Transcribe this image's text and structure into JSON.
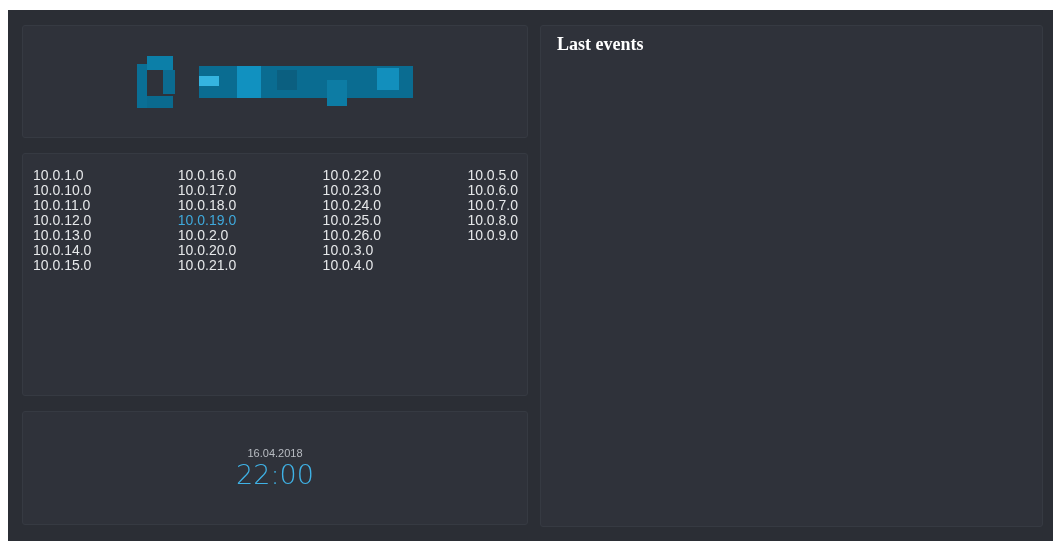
{
  "networks": [
    {
      "label": "10.0.1.0",
      "selected": false
    },
    {
      "label": "10.0.10.0",
      "selected": false
    },
    {
      "label": "10.0.11.0",
      "selected": false
    },
    {
      "label": "10.0.12.0",
      "selected": false
    },
    {
      "label": "10.0.13.0",
      "selected": false
    },
    {
      "label": "10.0.14.0",
      "selected": false
    },
    {
      "label": "10.0.15.0",
      "selected": false
    },
    {
      "label": "10.0.16.0",
      "selected": false
    },
    {
      "label": "10.0.17.0",
      "selected": false
    },
    {
      "label": "10.0.18.0",
      "selected": false
    },
    {
      "label": "10.0.19.0",
      "selected": true
    },
    {
      "label": "10.0.2.0",
      "selected": false
    },
    {
      "label": "10.0.20.0",
      "selected": false
    },
    {
      "label": "10.0.21.0",
      "selected": false
    },
    {
      "label": "10.0.22.0",
      "selected": false
    },
    {
      "label": "10.0.23.0",
      "selected": false
    },
    {
      "label": "10.0.24.0",
      "selected": false
    },
    {
      "label": "10.0.25.0",
      "selected": false
    },
    {
      "label": "10.0.26.0",
      "selected": false
    },
    {
      "label": "10.0.3.0",
      "selected": false
    },
    {
      "label": "10.0.4.0",
      "selected": false
    },
    {
      "label": "10.0.5.0",
      "selected": false
    },
    {
      "label": "10.0.6.0",
      "selected": false
    },
    {
      "label": "10.0.7.0",
      "selected": false
    },
    {
      "label": "10.0.8.0",
      "selected": false
    },
    {
      "label": "10.0.9.0",
      "selected": false
    }
  ],
  "clock": {
    "date": "16.04.2018",
    "time": "22:00"
  },
  "events": {
    "title": "Last events"
  }
}
